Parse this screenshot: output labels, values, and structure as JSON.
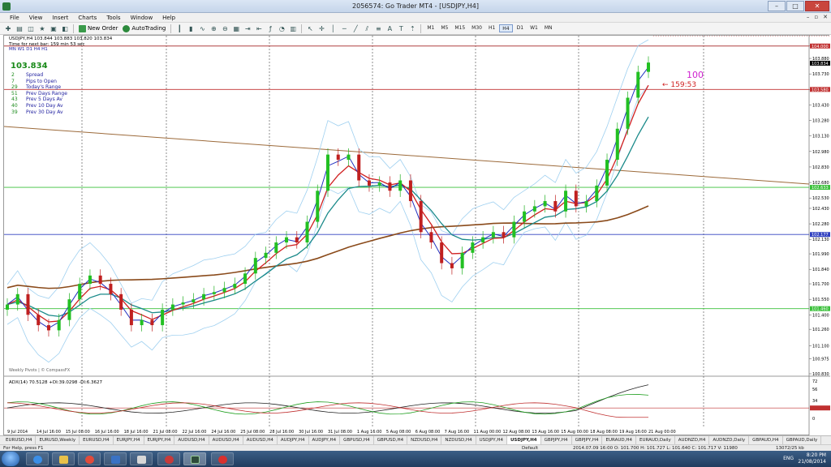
{
  "window": {
    "title": "2056574: Go Trader MT4 - [USDJPY,H4]"
  },
  "menu": [
    "File",
    "View",
    "Insert",
    "Charts",
    "Tools",
    "Window",
    "Help"
  ],
  "toolbar": {
    "new_order": "New Order",
    "autotrading": "AutoTrading",
    "timeframes": [
      "M1",
      "M5",
      "M15",
      "M30",
      "H1",
      "H4",
      "D1",
      "W1",
      "MN"
    ],
    "active_timeframe": "H4"
  },
  "chart_info": {
    "header": "USDJPY,H4  103.844 103.883 103.820 103.834",
    "next_bar": "Time for next bar: 159 min 53 sec",
    "tf_row": "MN  W1  D1  H4  H1",
    "last_price": "103.834",
    "stats": [
      {
        "v": "2",
        "l": "Spread"
      },
      {
        "v": "7",
        "l": "Pips to Open"
      },
      {
        "v": "29",
        "l": "Today's Range"
      },
      {
        "v": "51",
        "l": "Prev Days Range"
      },
      {
        "v": "43",
        "l": "Prev 5 Days Av"
      },
      {
        "v": "40",
        "l": "Prev 10 Day Av"
      },
      {
        "v": "39",
        "l": "Prev 30 Day Av"
      }
    ],
    "countdown": "159:53",
    "big_number": "100",
    "watermark": "Weekly Pivots | © CompassFX"
  },
  "chart_data": [
    {
      "type": "candlestick",
      "symbol": "USDJPY",
      "timeframe": "H4",
      "ylim": [
        100.83,
        104.1
      ],
      "y_ticks": [
        "104.000",
        "103.880",
        "103.730",
        "103.580",
        "103.430",
        "103.280",
        "103.130",
        "102.980",
        "102.830",
        "102.680",
        "102.530",
        "102.430",
        "102.280",
        "102.130",
        "101.990",
        "101.840",
        "101.700",
        "101.550",
        "101.400",
        "101.260",
        "101.100",
        "100.975",
        "100.830"
      ],
      "x_ticks": [
        "9 Jul 2014",
        "14 Jul 16:00",
        "15 Jul 08:00",
        "16 Jul 16:00",
        "18 Jul 16:00",
        "21 Jul 08:00",
        "22 Jul 16:00",
        "24 Jul 16:00",
        "25 Jul 08:00",
        "28 Jul 16:00",
        "30 Jul 16:00",
        "31 Jul 08:00",
        "1 Aug 16:00",
        "5 Aug 08:00",
        "6 Aug 08:00",
        "7 Aug 16:00",
        "11 Aug 00:00",
        "12 Aug 08:00",
        "13 Aug 16:00",
        "15 Aug 00:00",
        "18 Aug 08:00",
        "19 Aug 16:00",
        "21 Aug 00:00"
      ],
      "price_badges": [
        "104.000",
        "103.834",
        "103.580",
        "102.633",
        "102.177",
        "101.460"
      ],
      "pivot_labels": [
        {
          "label": "MR1  103.56",
          "value": 103.56
        },
        {
          "label": "wR.3",
          "value": 103.33
        },
        {
          "label": "wR.2",
          "value": 102.98
        },
        {
          "label": "wR.1",
          "value": 102.6
        },
        {
          "label": "wPV  102.31",
          "value": 102.31
        },
        {
          "label": "wS.1",
          "value": 101.92
        },
        {
          "label": "wS.2",
          "value": 101.62
        },
        {
          "label": "MS1  101.54",
          "value": 101.54
        },
        {
          "label": "wS.3",
          "value": 101.26
        }
      ],
      "close_path": [
        101.5,
        101.6,
        101.4,
        101.3,
        101.25,
        101.35,
        101.55,
        101.7,
        101.78,
        101.7,
        101.6,
        101.45,
        101.3,
        101.35,
        101.3,
        101.45,
        101.5,
        101.52,
        101.55,
        101.6,
        101.62,
        101.66,
        101.7,
        101.8,
        101.95,
        102.0,
        102.1,
        102.15,
        102.1,
        102.3,
        102.6,
        102.95,
        102.9,
        102.95,
        102.7,
        102.65,
        102.68,
        102.6,
        102.7,
        102.5,
        102.2,
        102.1,
        101.9,
        101.85,
        102.0,
        102.1,
        102.15,
        102.2,
        102.15,
        102.3,
        102.4,
        102.45,
        102.5,
        102.4,
        102.6,
        102.45,
        102.5,
        102.65,
        102.9,
        103.2,
        103.5,
        103.75,
        103.84
      ]
    },
    {
      "type": "line",
      "title": "ADX(14) 70.5128 +DI:39.0298 -DI:6.3627",
      "ylim": [
        0,
        75
      ],
      "y_ticks": [
        "72",
        "56",
        "34",
        "20.000",
        "0"
      ]
    }
  ],
  "symbol_tabs": [
    "EURUSD,H4",
    "EURUSD,Weekly",
    "EURUSD,H4",
    "EURJPY,H4",
    "EURJPY,H4",
    "AUDUSD,H4",
    "AUDUSD,H4",
    "AUDUSD,H4",
    "AUDJPY,H4",
    "AUDJPY,H4",
    "GBPUSD,H4",
    "GBPUSD,H4",
    "NZDUSD,H4",
    "NZDUSD,H4",
    "USDJPY,H4",
    "USDJPY,H4",
    "GBPJPY,H4",
    "GBPJPY,H4",
    "EURAUD,H4",
    "EURAUD,Daily",
    "AUDNZD,H4",
    "AUDNZD,Daily",
    "GBPAUD,H4",
    "GBPAUD,Daily"
  ],
  "active_tab": 15,
  "status": {
    "help": "For Help, press F1",
    "profile": "Default",
    "bar": "2014.07.09 16:00  O: 101.700  H: 101.727  L: 101.640  C: 101.717  V: 11980",
    "traffic": "13072/25 kb"
  },
  "taskbar": {
    "lang": "ENG",
    "time": "8:20 PM",
    "date": "21/08/2014"
  }
}
